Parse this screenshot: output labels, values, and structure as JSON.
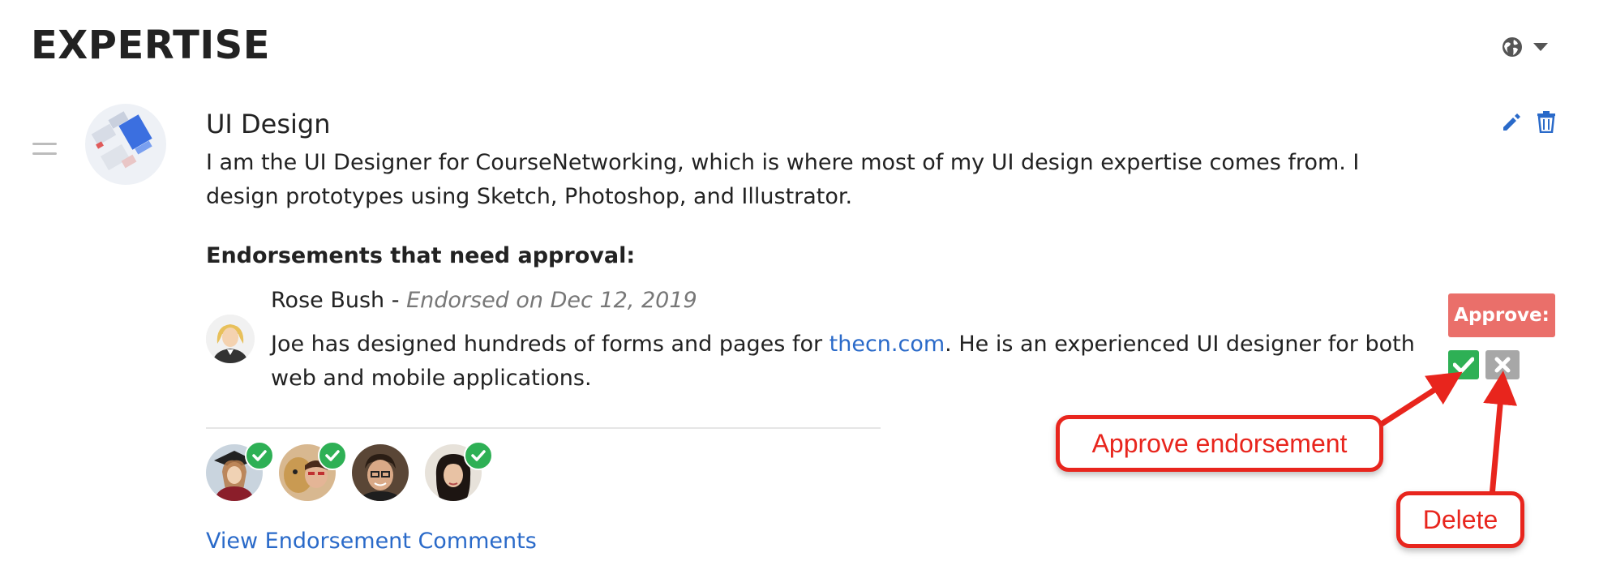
{
  "section": {
    "title": "EXPERTISE"
  },
  "header_controls": {
    "globe_icon": "globe-icon",
    "dropdown_icon": "caret-down-icon"
  },
  "expertise_item": {
    "title": "UI Design",
    "description": "I am the UI Designer for CourseNetworking, which is where most of my UI design expertise comes from. I design prototypes using Sketch, Photoshop, and Illustrator.",
    "edit_icon": "pencil-icon",
    "delete_icon": "trash-icon"
  },
  "endorsements": {
    "heading": "Endorsements that need approval:",
    "pending": {
      "name": "Rose Bush",
      "separator": " - ",
      "date_text": "Endorsed on Dec 12, 2019",
      "text_before": "Joe has designed hundreds of forms and pages for ",
      "link_text": "thecn.com",
      "text_after": ". He is an experienced UI designer for both web and mobile applications."
    },
    "approve_label": "Approve:",
    "endorsers": [
      {
        "approved": true
      },
      {
        "approved": true
      },
      {
        "approved": false
      },
      {
        "approved": true
      }
    ],
    "view_comments": "View Endorsement Comments"
  },
  "annotations": {
    "approve_callout": "Approve endorsement",
    "delete_callout": "Delete"
  },
  "colors": {
    "accent_blue": "#2a6ac9",
    "approve_red": "#ea6f6a",
    "check_green": "#2eb055",
    "delete_gray": "#a7a7a7",
    "annotation_red": "#e8251d"
  }
}
